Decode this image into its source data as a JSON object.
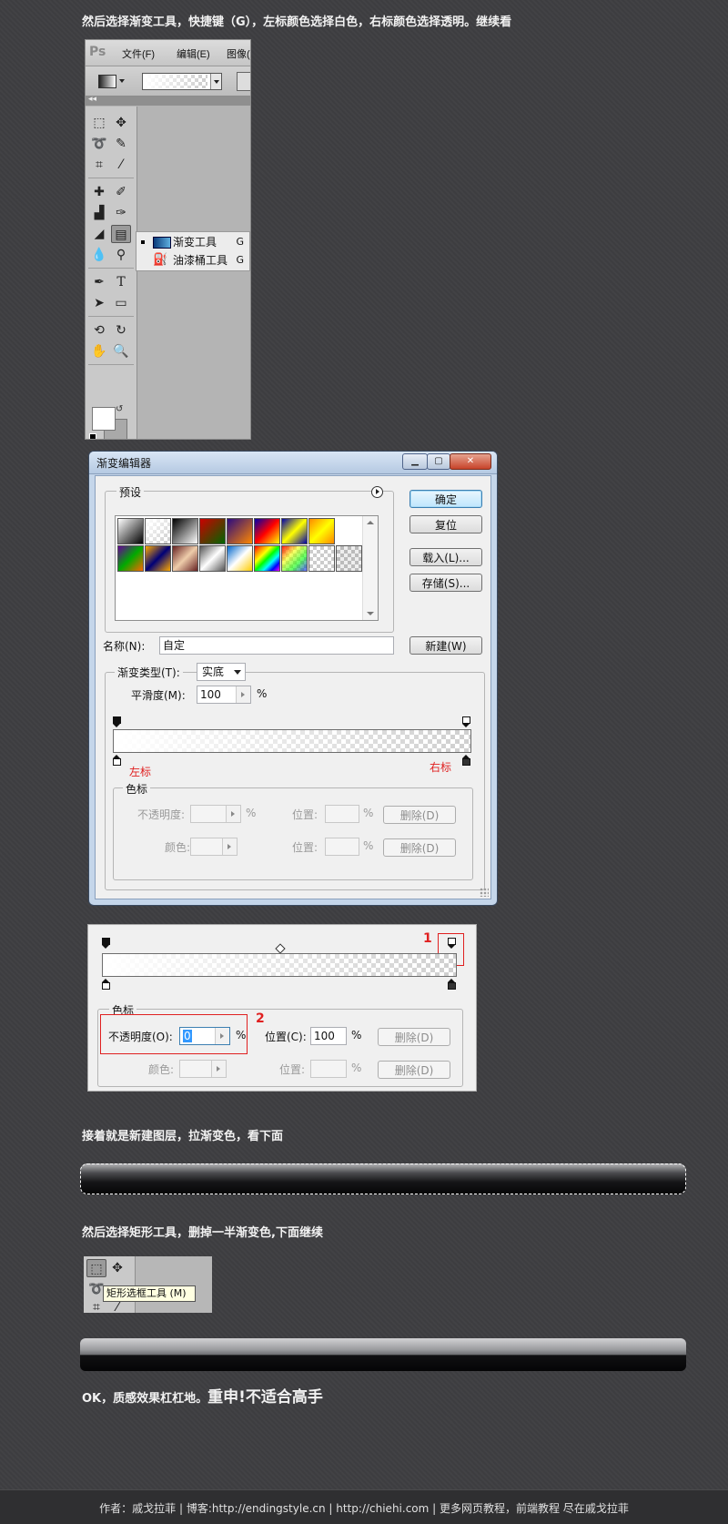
{
  "captions": {
    "step1": "然后选择渐变工具，快捷键（G），左标颜色选择白色，右标颜色选择透明。继续看",
    "step2": "接着就是新建图层，拉渐变色，看下面",
    "step3": "然后选择矩形工具，删掉一半渐变色,下面继续",
    "step4_normal": "OK，质感效果杠杠地。",
    "step4_big": "重申!不适合高手"
  },
  "photoshop": {
    "logo": "Ps",
    "menu": [
      "文件(F)",
      "编辑(E)",
      "图像("
    ],
    "flyout": [
      {
        "label": "渐变工具",
        "shortcut": "G",
        "icon": "gradient-icon",
        "selected": true
      },
      {
        "label": "油漆桶工具",
        "shortcut": "G",
        "icon": "paint-bucket-icon",
        "selected": false
      }
    ],
    "tools": {
      "type_tool": "T",
      "foreground_color": "#ffffff",
      "background_color": "#a9a9a9"
    }
  },
  "gradient_editor": {
    "title": "渐变编辑器",
    "presets_label": "预设",
    "buttons": {
      "ok": "确定",
      "reset": "复位",
      "load": "载入(L)...",
      "save": "存储(S)...",
      "new": "新建(W)"
    },
    "name_label": "名称(N):",
    "name_value": "自定",
    "gradient_type_label": "渐变类型(T):",
    "gradient_type_value": "实底",
    "smoothness_label": "平滑度(M):",
    "smoothness_value": "100",
    "percent": "%",
    "left_stop_label": "左标",
    "right_stop_label": "右标",
    "stops_group_label": "色标",
    "opacity_label": "不透明度:",
    "location_label": "位置:",
    "color_label": "颜色:",
    "delete_label": "删除(D)"
  },
  "stop_detail": {
    "marker1": "1",
    "marker2": "2",
    "stops_group_label": "色标",
    "opacity_label": "不透明度(O):",
    "opacity_value": "0",
    "location_label": "位置(C):",
    "location_value": "100",
    "percent": "%",
    "delete_label": "删除(D)",
    "color_label": "颜色:",
    "location_label_dis": "位置:"
  },
  "tooltip": {
    "text": "矩形选框工具 (M)"
  },
  "footer": {
    "text": "作者：戚戈拉菲 | 博客:http://endingstyle.cn | http://chiehi.com | 更多网页教程，前端教程 尽在戚戈拉菲"
  }
}
